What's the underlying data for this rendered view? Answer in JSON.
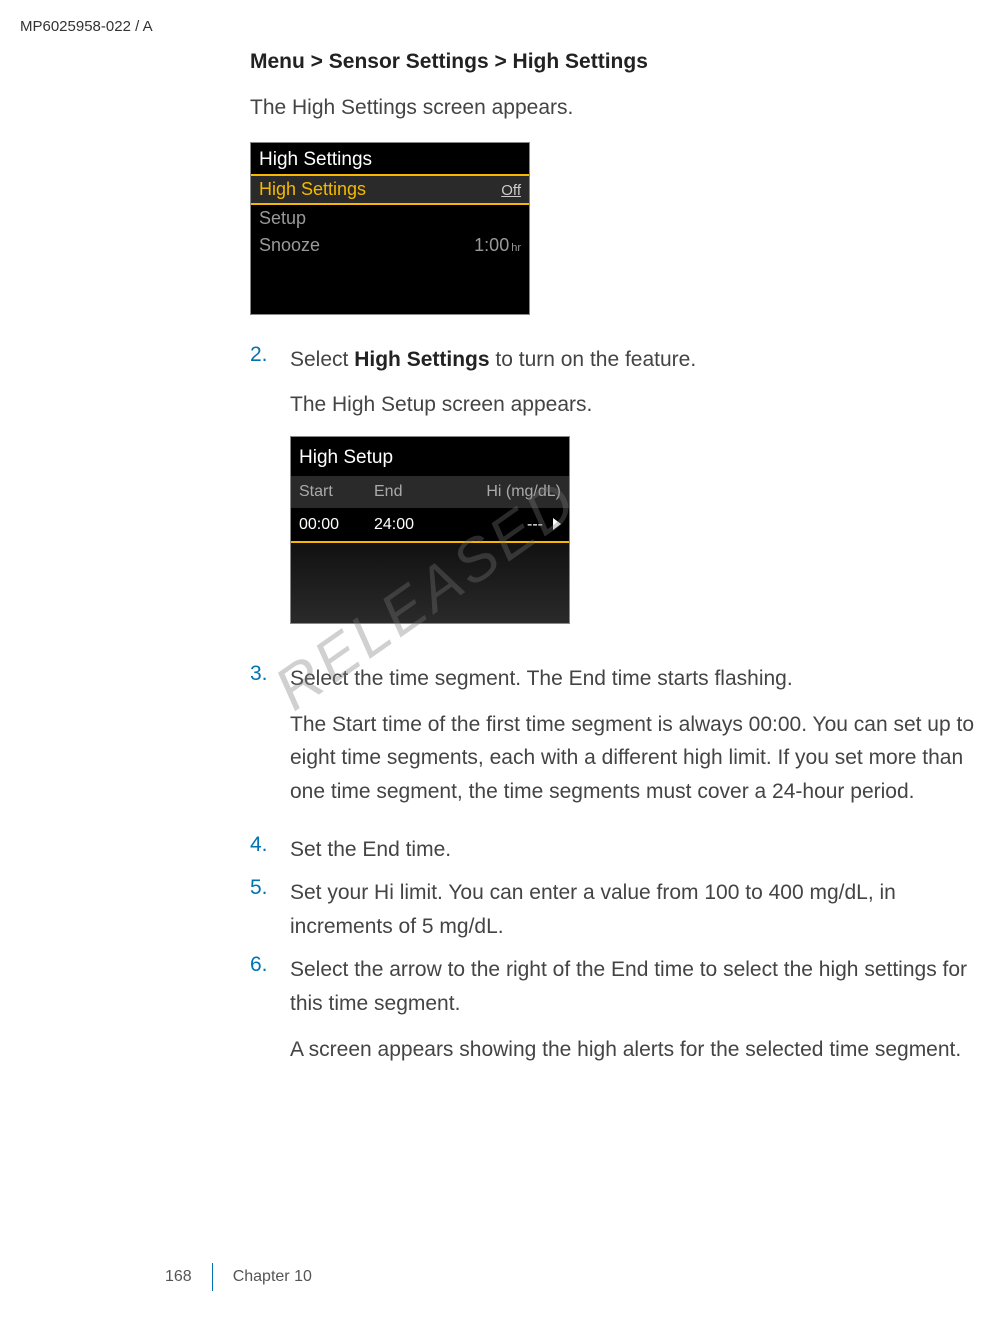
{
  "header": {
    "doc_id": "MP6025958-022 / A"
  },
  "breadcrumb": "Menu > Sensor Settings > High Settings",
  "intro_text": "The High Settings screen appears.",
  "screen1": {
    "title": "High Settings",
    "rows": [
      {
        "label": "High Settings",
        "value": "Off"
      },
      {
        "label": "Setup",
        "value": ""
      },
      {
        "label": "Snooze",
        "value": "1:00",
        "unit": "hr"
      }
    ]
  },
  "step2": {
    "num": "2.",
    "text_prefix": "Select ",
    "bold": "High Settings",
    "text_suffix": " to turn on the feature.",
    "sub": "The High Setup screen appears."
  },
  "screen2": {
    "title": "High Setup",
    "cols": {
      "c1": "Start",
      "c2": "End",
      "c3": "Hi (mg/dL)"
    },
    "row": {
      "start": "00:00",
      "end": "24:00",
      "hi": "---"
    }
  },
  "step3": {
    "num": "3.",
    "line1": "Select the time segment. The End time starts flashing.",
    "line2": "The Start time of the first time segment is always 00:00. You can set up to eight time segments, each with a different high limit. If you set more than one time segment, the time segments must cover a 24-hour period."
  },
  "step4": {
    "num": "4.",
    "text": "Set the End time."
  },
  "step5": {
    "num": "5.",
    "text": "Set your Hi limit. You can enter a value from 100 to 400 mg/dL, in increments of 5 mg/dL."
  },
  "step6": {
    "num": "6.",
    "line1": "Select the arrow to the right of the End time to select the high settings for this time segment.",
    "line2": "A screen appears showing the high alerts for the selected time segment."
  },
  "watermark": "RELEASED",
  "footer": {
    "page": "168",
    "chapter": "Chapter 10"
  }
}
